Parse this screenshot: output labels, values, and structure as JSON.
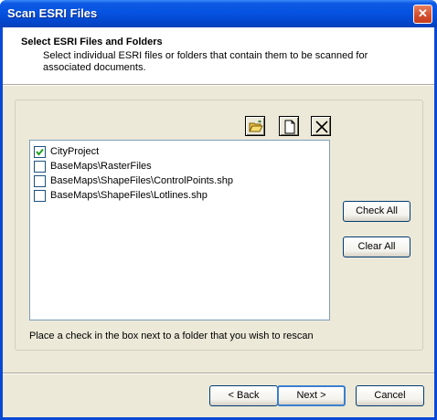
{
  "window": {
    "title": "Scan ESRI Files",
    "close_glyph": "✕"
  },
  "header": {
    "title": "Select ESRI Files and Folders",
    "description": "Select individual ESRI files or folders that contain them to be scanned for associated documents."
  },
  "toolbar": {
    "icons": [
      "open-folder-icon",
      "new-file-icon",
      "delete-icon"
    ]
  },
  "list": {
    "items": [
      {
        "label": "CityProject",
        "checked": true
      },
      {
        "label": "BaseMaps\\RasterFiles",
        "checked": false
      },
      {
        "label": "BaseMaps\\ShapeFiles\\ControlPoints.shp",
        "checked": false
      },
      {
        "label": "BaseMaps\\ShapeFiles\\Lotlines.shp",
        "checked": false
      }
    ]
  },
  "side_buttons": {
    "check_all": "Check All",
    "clear_all": "Clear All"
  },
  "hint": "Place a check in the box next to a folder that you wish to rescan",
  "footer": {
    "back": "< Back",
    "next": "Next >",
    "cancel": "Cancel"
  },
  "colors": {
    "titlebar": "#0553e1",
    "dialog_bg": "#ece9d8",
    "accent_border": "#003c74"
  }
}
